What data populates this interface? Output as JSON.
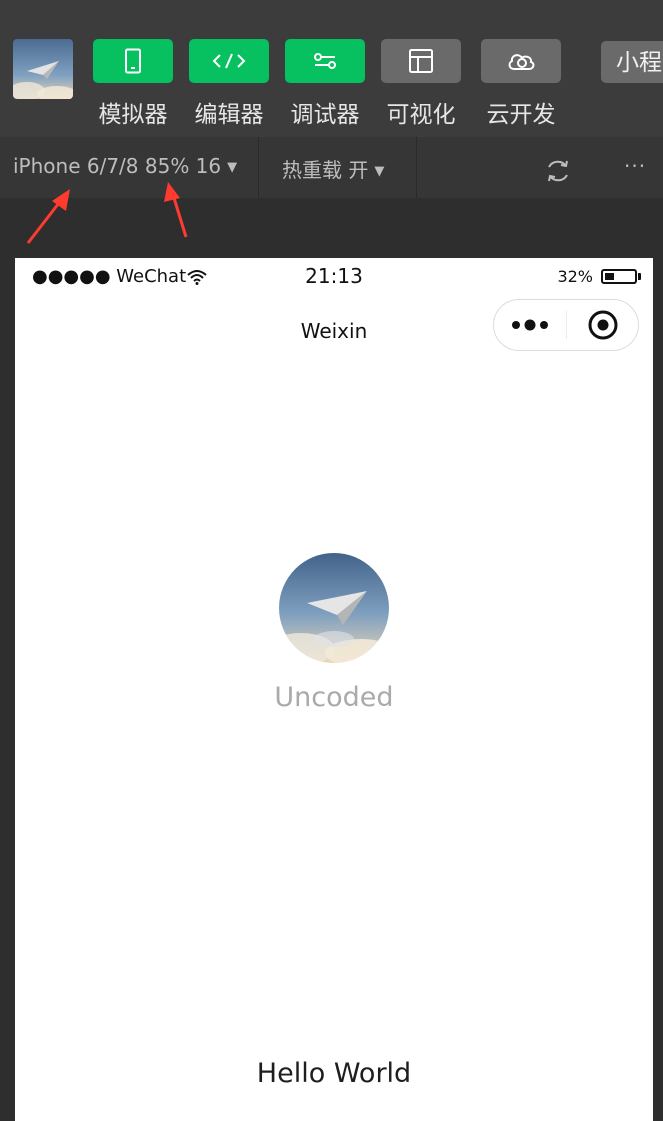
{
  "toolbar": {
    "items": [
      {
        "label": "模拟器",
        "icon": "phone-icon",
        "active": true
      },
      {
        "label": "编辑器",
        "icon": "code-icon",
        "active": true
      },
      {
        "label": "调试器",
        "icon": "debug-icon",
        "active": true
      },
      {
        "label": "可视化",
        "icon": "layout-icon",
        "active": false
      },
      {
        "label": "云开发",
        "icon": "cloud-icon",
        "active": false
      }
    ],
    "mini_program_label": "小程"
  },
  "subbar": {
    "device": "iPhone 6/7/8 85% 16",
    "hot_reload": "热重载 开",
    "more": "···"
  },
  "phone": {
    "carrier": "●●●●● WeChat",
    "time": "21:13",
    "battery": "32%",
    "battery_level": 0.32,
    "nav_title": "Weixin",
    "nickname": "Uncoded",
    "hello": "Hello World"
  },
  "colors": {
    "green": "#07c160",
    "grey_button": "#6a6a6a",
    "annotation_arrow": "#ff3b30"
  }
}
